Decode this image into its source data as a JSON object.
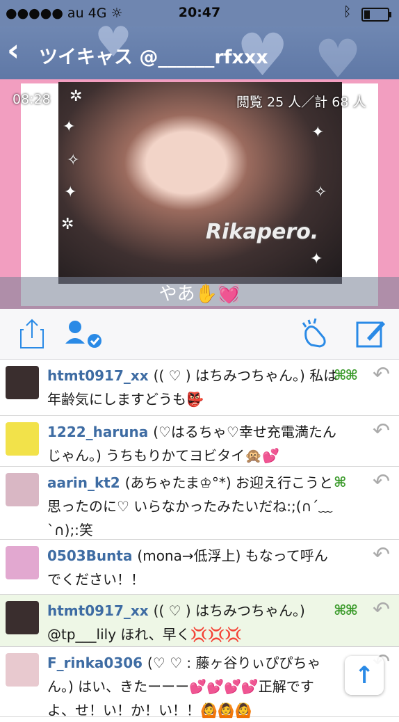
{
  "status_bar": {
    "carrier": "●●●●● au  4G  ☼",
    "time": "20:47",
    "bluetooth_icon": "bluetooth-icon",
    "battery_icon": "battery-low-icon"
  },
  "nav": {
    "back_icon": "chevron-left-icon",
    "title": "ツイキャス @______rfxxx"
  },
  "video": {
    "elapsed": "08:28",
    "viewers": "閲覧 25 人／計 68 人",
    "watermark": "Rikapero.",
    "caption": "やあ✋💓"
  },
  "toolbar": {
    "share_icon": "share-icon",
    "follow_icon": "user-check-icon",
    "clap_icon": "clap-icon",
    "compose_icon": "compose-icon"
  },
  "comments": [
    {
      "user": "htmt0917_xx",
      "text": "(( ♡ ) はちみつちゃん。) 私は年齢気にしますどうも👺",
      "badge": "⌘⌘",
      "avatar_color": "#3a2e2e",
      "highlight": false
    },
    {
      "user": "1222_haruna",
      "text": "(♡はるちゃ♡幸せ充電満たんじゃん。) うちもりかてヨビタイ🙊💕",
      "badge": "",
      "avatar_color": "#f2e24a",
      "highlight": false
    },
    {
      "user": "aarin_kt2",
      "text": "(あちゃたま♔°*) お迎え行こうと思ったのに♡ いらなかったみたいだね:;(∩´﹏`∩);:笑",
      "badge": "⌘",
      "avatar_color": "#d9b7c4",
      "highlight": false
    },
    {
      "user": "0503Bunta",
      "text": "(mona→低浮上) もなって呼んでください！！",
      "badge": "",
      "avatar_color": "#e2a8d0",
      "highlight": false
    },
    {
      "user": "htmt0917_xx",
      "text": "(( ♡ ) はちみつちゃん。) @tp___lily ほれ、早く💢💢💢",
      "badge": "⌘⌘",
      "avatar_color": "#3a2e2e",
      "highlight": true
    },
    {
      "user": "F_rinka0306",
      "text": "(♡ ♡ : 藤ヶ谷りぃぴぴちゃん。) はい、きたーーー💕💕💕💕正解ですよ、せ！い！か！い！！🙆🙆🙆",
      "badge": "",
      "avatar_color": "#e8c9cf",
      "highlight": false
    }
  ],
  "scroll_top_icon": "arrow-up-icon"
}
